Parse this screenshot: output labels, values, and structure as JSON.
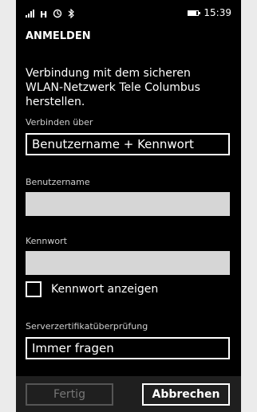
{
  "status_bar": {
    "carrier": "H",
    "time": "15:39",
    "battery_level": 0.8
  },
  "page": {
    "title": "ANMELDEN",
    "description": "Verbindung mit dem sicheren WLAN-Netzwerk Tele Columbus herstellen."
  },
  "connect_via": {
    "label": "Verbinden über",
    "value": "Benutzername + Kennwort"
  },
  "username": {
    "label": "Benutzername",
    "value": ""
  },
  "password": {
    "label": "Kennwort",
    "value": ""
  },
  "show_password": {
    "label": "Kennwort anzeigen",
    "checked": false
  },
  "certificate": {
    "label": "Serverzertifikatüberprüfung",
    "value": "Immer fragen"
  },
  "buttons": {
    "done": "Fertig",
    "cancel": "Abbrechen"
  }
}
